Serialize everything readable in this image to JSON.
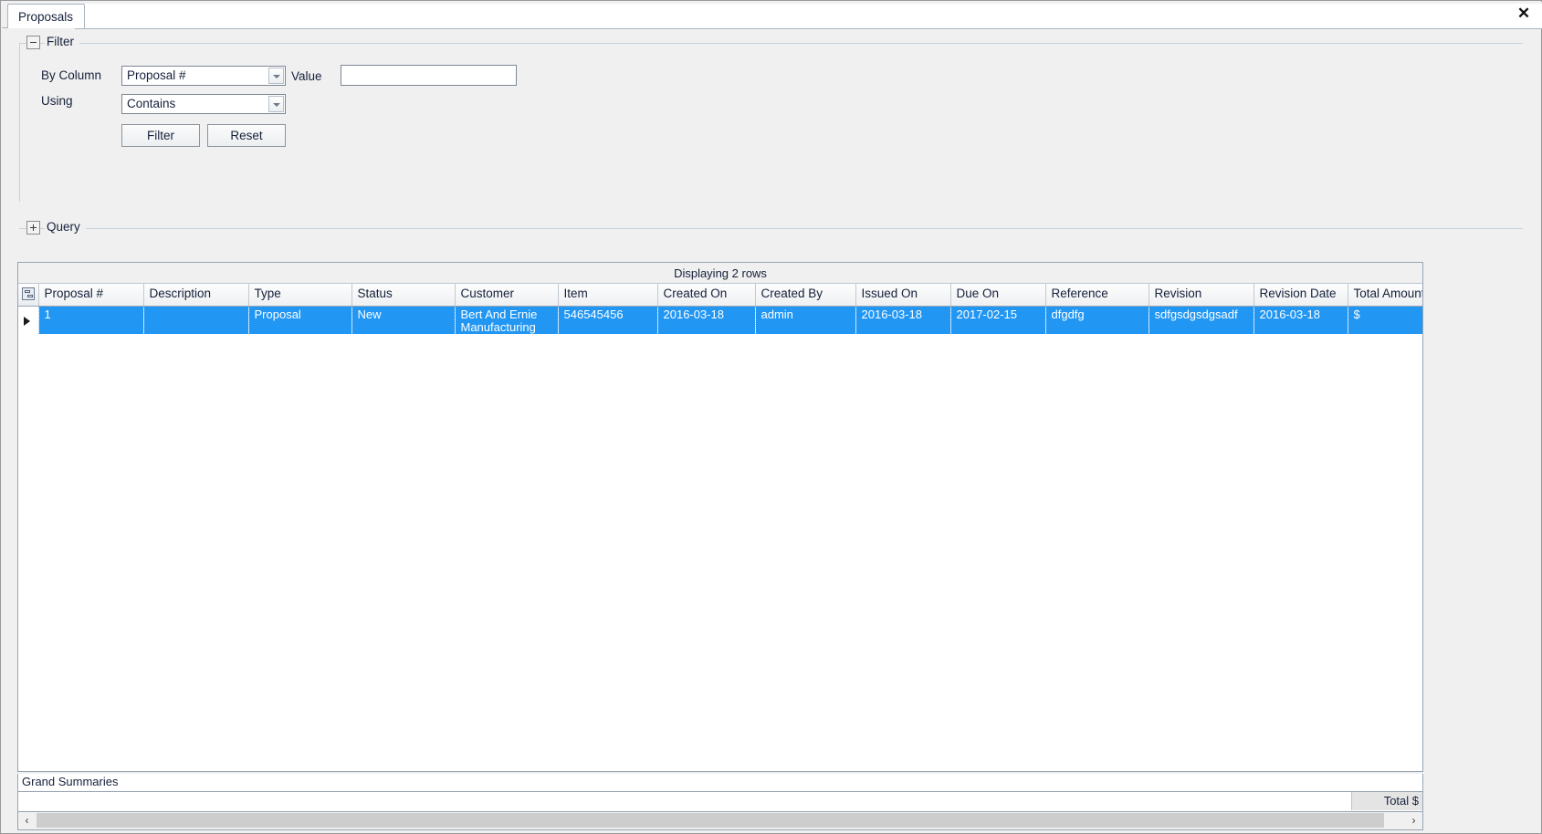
{
  "window": {
    "close_label": "✕"
  },
  "tabs": [
    {
      "label": "Proposals"
    }
  ],
  "filter_section": {
    "title": "Filter",
    "toggle_state": "expanded",
    "by_column_label": "By Column",
    "by_column_value": "Proposal #",
    "using_label": "Using",
    "using_value": "Contains",
    "value_label": "Value",
    "value_text": "",
    "value_placeholder": "",
    "filter_button": "Filter",
    "reset_button": "Reset"
  },
  "query_section": {
    "title": "Query",
    "toggle_state": "collapsed"
  },
  "grid": {
    "caption": "Displaying 2 rows",
    "columns": [
      {
        "key": "indicator",
        "label": ""
      },
      {
        "key": "proposal_no",
        "label": "Proposal #"
      },
      {
        "key": "description",
        "label": "Description"
      },
      {
        "key": "type",
        "label": "Type"
      },
      {
        "key": "status",
        "label": "Status"
      },
      {
        "key": "customer",
        "label": "Customer"
      },
      {
        "key": "item",
        "label": "Item"
      },
      {
        "key": "created_on",
        "label": "Created On"
      },
      {
        "key": "created_by",
        "label": "Created By"
      },
      {
        "key": "issued_on",
        "label": "Issued On"
      },
      {
        "key": "due_on",
        "label": "Due On"
      },
      {
        "key": "reference",
        "label": "Reference"
      },
      {
        "key": "revision",
        "label": "Revision"
      },
      {
        "key": "revision_date",
        "label": "Revision Date"
      },
      {
        "key": "total_amount",
        "label": "Total Amount"
      }
    ],
    "rows": [
      {
        "selected": true,
        "current": true,
        "proposal_no": "1",
        "description": "",
        "type": "Proposal",
        "status": "New",
        "customer": "Bert And Ernie Manufacturing",
        "item": "546545456",
        "created_on": "2016-03-18",
        "created_by": "admin",
        "issued_on": "2016-03-18",
        "due_on": "2017-02-15",
        "reference": "dfgdfg",
        "revision": "sdfgsdgsdgsadf",
        "revision_date": "2016-03-18",
        "total_amount": "$"
      }
    ]
  },
  "summaries": {
    "label": "Grand Summaries",
    "total_label": "Total $"
  },
  "scrollbar": {
    "left_arrow": "‹",
    "right_arrow": "›"
  },
  "colors": {
    "selection": "#2196f3",
    "panel": "#f0f0f0",
    "border": "#97a4b2"
  }
}
